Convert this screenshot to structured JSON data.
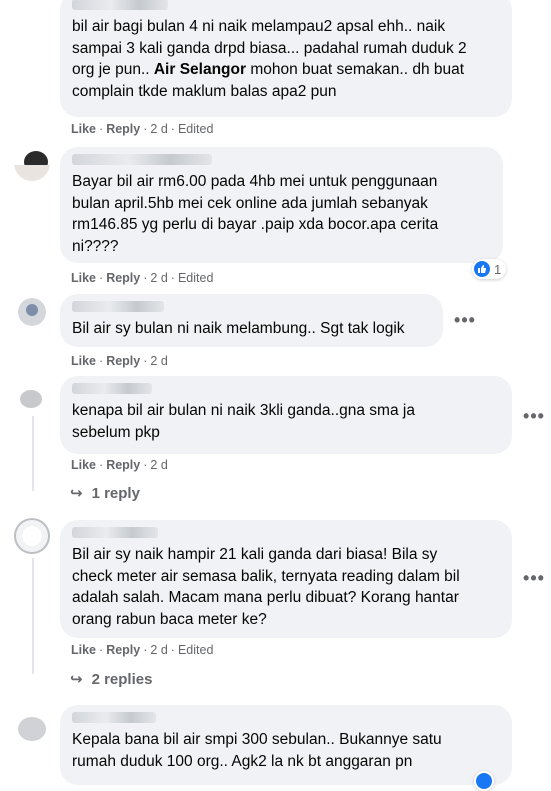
{
  "comments": [
    {
      "lines": [
        "bil air bagi bulan 4 ni naik melampau2 apsal ehh.. naik",
        "sampai 3 kali ganda drpd biasa... padahal rumah duduk 2",
        "org je pun.. ",
        "complain tkde maklum balas apa2 pun"
      ],
      "mention": "Air Selangor",
      "line3_after": " mohon buat semakan.. dh buat",
      "like": "Like",
      "reply": "Reply",
      "time": "2 d",
      "edited": "Edited"
    },
    {
      "lines": [
        "Bayar bil air rm6.00 pada 4hb mei untuk penggunaan",
        "bulan april.5hb mei cek online ada jumlah sebanyak",
        "rm146.85 yg perlu di bayar .paip xda bocor.apa cerita",
        "ni????"
      ],
      "like": "Like",
      "reply": "Reply",
      "time": "2 d",
      "edited": "Edited",
      "reaction_count": "1"
    },
    {
      "lines": [
        "Bil air sy bulan ni naik melambung.. Sgt tak logik"
      ],
      "like": "Like",
      "reply": "Reply",
      "time": "2 d",
      "more": "•••"
    },
    {
      "lines": [
        "kenapa bil air bulan ni naik 3kli ganda..gna sma ja",
        "sebelum pkp"
      ],
      "like": "Like",
      "reply": "Reply",
      "time": "2 d",
      "more": "•••",
      "replies": "1 reply"
    },
    {
      "lines": [
        "Bil air sy naik hampir 21 kali ganda dari biasa! Bila sy",
        "check meter air semasa balik, ternyata reading dalam bil",
        "adalah salah. Macam mana perlu dibuat? Korang hantar",
        "orang rabun baca meter ke?"
      ],
      "like": "Like",
      "reply": "Reply",
      "time": "2 d",
      "edited": "Edited",
      "more": "•••",
      "replies": "2 replies"
    },
    {
      "lines": [
        "Kepala bana bil air smpi 300 sebulan.. Bukannye satu",
        "rumah duduk 100 org.. Agk2 la nk bt anggaran pn"
      ]
    }
  ],
  "separator": "·",
  "icons": {
    "more": "more-options-icon",
    "like_badge": "thumbs-up-icon",
    "reply_arrow": "reply-arrow-icon"
  },
  "colors": {
    "bubble": "#f0f2f5",
    "meta": "#65676b",
    "like_blue": "#1877f2"
  }
}
